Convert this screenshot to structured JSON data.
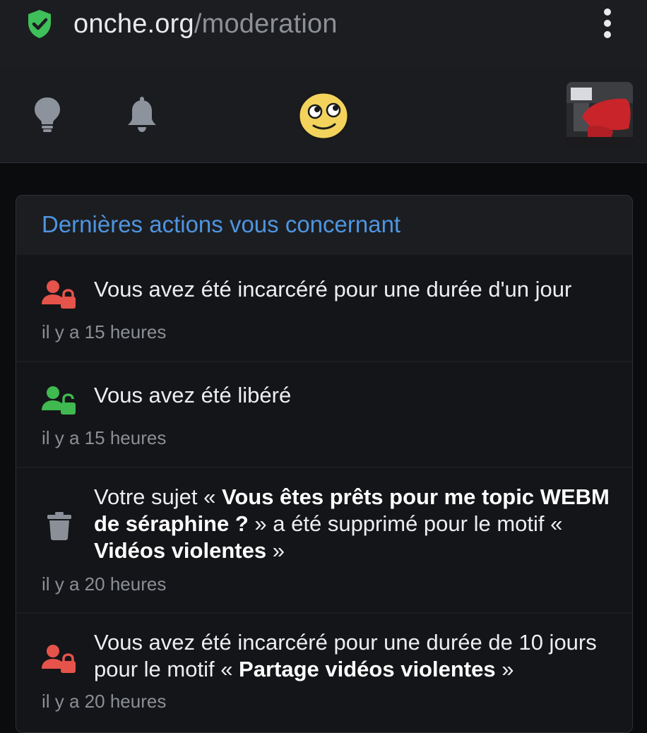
{
  "browser": {
    "url_host": "onche.org",
    "url_path": "/moderation",
    "secure_icon": "shield-check-icon",
    "menu_icon": "kebab-menu-icon"
  },
  "nav": {
    "icons": [
      "lightbulb-icon",
      "bell-icon",
      "smiley-logo",
      "avatar"
    ]
  },
  "card": {
    "title": "Dernières actions vous concernant",
    "items": [
      {
        "icon": "user-lock-icon",
        "icon_color": "#e5534b",
        "text": "Vous avez été incarcéré pour une durée d'un jour",
        "time": "il y a 15 heures"
      },
      {
        "icon": "user-unlock-icon",
        "icon_color": "#3fb950",
        "text": "Vous avez été libéré",
        "time": "il y a 15 heures"
      },
      {
        "icon": "trash-icon",
        "icon_color": "#8a8f98",
        "text_pre": "Votre sujet « ",
        "text_bold1": "Vous êtes prêts pour me topic WEBM de séraphine ?",
        "text_mid": " » a été supprimé pour le motif « ",
        "text_bold2": "Vidéos violentes",
        "text_post": " »",
        "time": "il y a 20 heures"
      },
      {
        "icon": "user-lock-icon",
        "icon_color": "#e5534b",
        "text_pre": "Vous avez été incarcéré pour une durée de 10 jours pour le motif « ",
        "text_bold1": "Partage vidéos violentes",
        "text_post": " »",
        "time": "il y a 20 heures"
      }
    ]
  }
}
